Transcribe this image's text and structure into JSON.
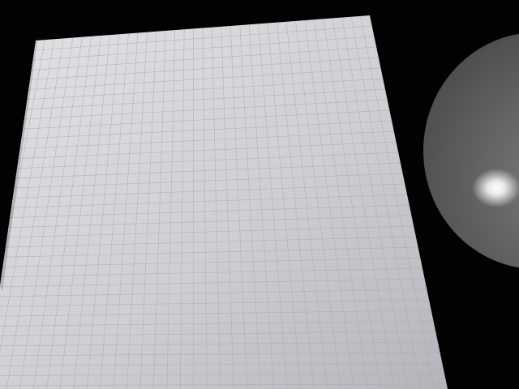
{
  "scene": {
    "background_color": "#020202",
    "paper": {
      "kind": "graph-paper-sheet",
      "base_color": "#cfcfd3",
      "highlight_color": "#e2e2e6",
      "shadow_color": "#b4b4ba",
      "grid_line_color": "#a9abb8"
    },
    "lamp_disc": {
      "kind": "round-lamp-shade",
      "base_color": "#7d7d7d",
      "edge_color": "#4c4c4c",
      "reflection_color": "#ffffff"
    }
  }
}
